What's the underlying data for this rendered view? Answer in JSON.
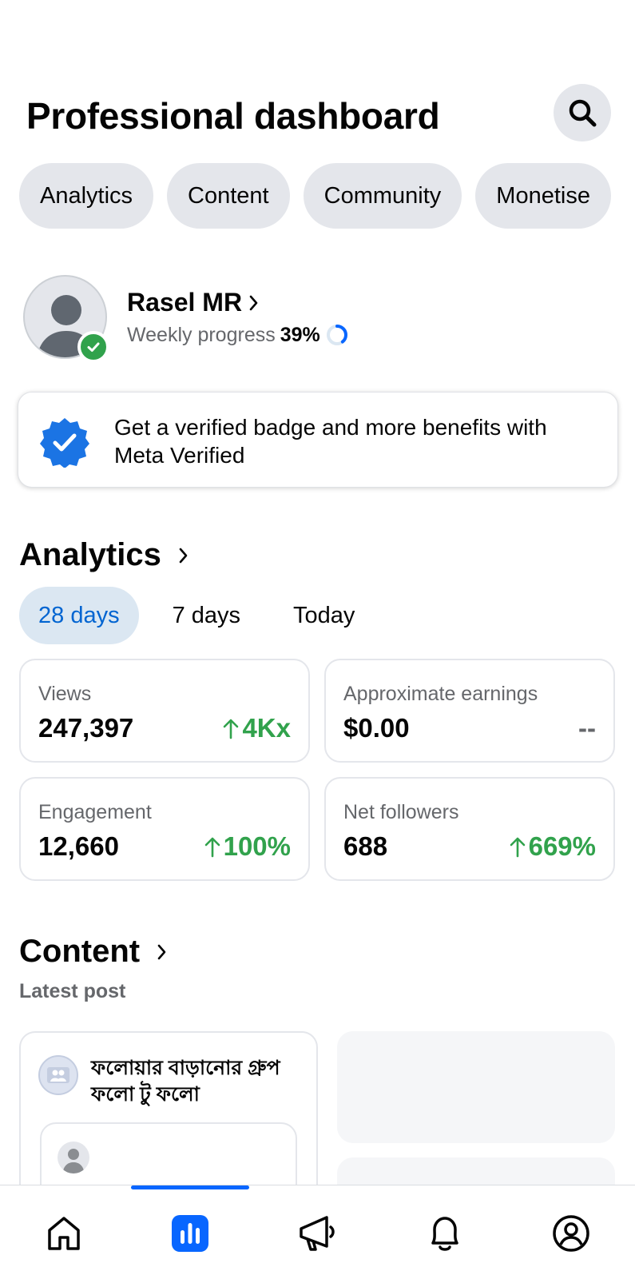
{
  "header": {
    "title": "Professional dashboard"
  },
  "chips": [
    "Analytics",
    "Content",
    "Community",
    "Monetise"
  ],
  "profile": {
    "name": "Rasel MR",
    "progress_label": "Weekly progress",
    "progress_value": "39%",
    "progress_fraction": 0.39
  },
  "meta_verified": {
    "text": "Get a verified badge and more benefits with Meta Verified"
  },
  "analytics": {
    "title": "Analytics",
    "ranges": [
      "28 days",
      "7 days",
      "Today"
    ],
    "selected_range": "28 days",
    "metrics": [
      {
        "label": "Views",
        "value": "247,397",
        "change": "4Kx"
      },
      {
        "label": "Approximate earnings",
        "value": "$0.00",
        "change": "--"
      },
      {
        "label": "Engagement",
        "value": "12,660",
        "change": "100%"
      },
      {
        "label": "Net followers",
        "value": "688",
        "change": "669%"
      }
    ]
  },
  "content": {
    "title": "Content",
    "subtitle": "Latest post",
    "post_title": "ফলোয়ার বাড়ানোর গ্রুপ ফলো টু ফলো"
  },
  "nav": {
    "items": [
      "home-icon",
      "dashboard-icon",
      "megaphone-icon",
      "bell-icon",
      "profile-icon"
    ],
    "active": "dashboard-icon"
  },
  "colors": {
    "accent": "#0866ff",
    "positive": "#31a24c",
    "chip_bg": "#e4e6eb"
  }
}
